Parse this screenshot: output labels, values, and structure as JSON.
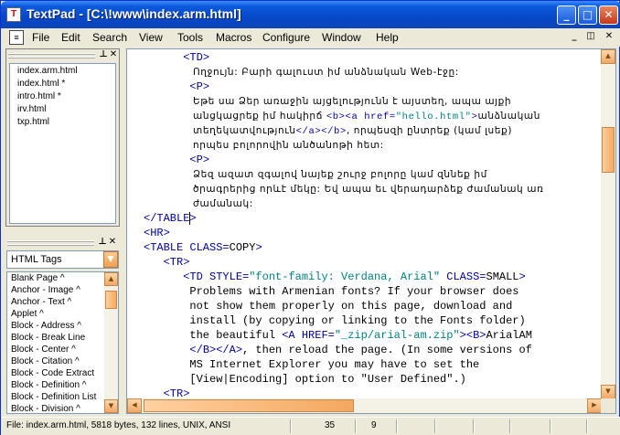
{
  "window": {
    "title": "TextPad - [C:\\!www\\index.arm.html]",
    "app_icon": "textpad-app-icon",
    "title_icon_glyph": "T",
    "controls": {
      "minimize": "_",
      "maximize": "□",
      "close": "✕"
    }
  },
  "menubar": {
    "items": [
      "File",
      "Edit",
      "Search",
      "View",
      "Tools",
      "Macros",
      "Configure",
      "Window",
      "Help"
    ],
    "app_icon_glyph": "≡",
    "mdi_controls": {
      "minimize": "_",
      "restore": "◫",
      "close": "✕"
    }
  },
  "document_selector": {
    "files": [
      "index.arm.html",
      "index.html *",
      "intro.html *",
      "irv.html",
      "txp.html"
    ],
    "selected": "index.arm.html",
    "pin_glyph": "⊥",
    "close_glyph": "✕"
  },
  "clip_library": {
    "selected_library": "HTML Tags",
    "dropdown_glyph": "▼",
    "pin_glyph": "⊥",
    "close_glyph": "✕",
    "items": [
      "Blank Page ^",
      "Anchor - Image ^",
      "Anchor - Text ^",
      "Applet ^",
      "Block - Address ^",
      "Block - Break Line",
      "Block - Center ^",
      "Block - Citation ^",
      "Block - Code Extract",
      "Block - Definition ^",
      "Block - Definition List",
      "Block - Division ^"
    ],
    "scroll_up_glyph": "▲",
    "scroll_down_glyph": "▼"
  },
  "editor": {
    "lines": [
      [
        {
          "t": "      "
        },
        {
          "t": "<TD>",
          "c": "tag"
        }
      ],
      [
        {
          "t": "Ողջույն: Բարի գալուստ իմ անձնական Web-էջը:",
          "arm": true
        }
      ],
      [
        {
          "t": "       "
        },
        {
          "t": "<P>",
          "c": "tag"
        }
      ],
      [
        {
          "t": "Եթե սա Ձեր առաջին այցելությունն է այստեղ, ապա այքի",
          "arm": true
        }
      ],
      [
        {
          "t": "անցկացրեք իմ հակիրճ ",
          "arm": true
        },
        {
          "t": "<b><a href=",
          "c": "tag"
        },
        {
          "t": "\"hello.html\"",
          "c": "str"
        },
        {
          "t": ">",
          "c": "tag"
        },
        {
          "t": "անձնական",
          "arm": true
        }
      ],
      [
        {
          "t": "տեղեկատվություն",
          "arm": true
        },
        {
          "t": "</a></b>",
          "c": "tag"
        },
        {
          "t": ", որպեսզի ընտրեք (կամ լսեք)",
          "arm": true
        }
      ],
      [
        {
          "t": "որպես բոլորովին անծանոթի հետ:",
          "arm": true
        }
      ],
      [
        {
          "t": "       "
        },
        {
          "t": "<P>",
          "c": "tag"
        }
      ],
      [
        {
          "t": "Ձեզ ազատ զգալով նայեք շուրջ բոլորը կամ զննեք իմ",
          "arm": true
        }
      ],
      [
        {
          "t": "ծրագրերից որևէ մեկը: Եվ ապա եւ վերադարձեք ժամանակ առ",
          "arm": true
        }
      ],
      [
        {
          "t": "ժամանակ:",
          "arm": true
        }
      ],
      [
        {
          "t": "</TABLE>",
          "c": "tag"
        }
      ],
      [
        {
          "t": "<HR>",
          "c": "tag"
        }
      ],
      [
        {
          "t": "<TABLE CLASS=",
          "c": "tag"
        },
        {
          "t": "COPY"
        },
        {
          "t": ">",
          "c": "tag"
        }
      ],
      [
        {
          "t": "   "
        },
        {
          "t": "<TR>",
          "c": "tag"
        }
      ],
      [
        {
          "t": "      "
        },
        {
          "t": "<TD STYLE=",
          "c": "tag"
        },
        {
          "t": "\"font-family: Verdana, Arial\"",
          "c": "str"
        },
        {
          "t": " CLASS=",
          "c": "tag"
        },
        {
          "t": "SMALL"
        },
        {
          "t": ">",
          "c": "tag"
        }
      ],
      [
        {
          "t": "       Problems with Armenian fonts? If your browser does"
        }
      ],
      [
        {
          "t": "       not show them properly on this page, download and"
        }
      ],
      [
        {
          "t": "       install (by copying or linking to the Fonts folder)"
        }
      ],
      [
        {
          "t": "       the beautiful "
        },
        {
          "t": "<A HREF=",
          "c": "tag"
        },
        {
          "t": "\"_zip/arial-am.zip\"",
          "c": "str"
        },
        {
          "t": "><B>",
          "c": "tag"
        },
        {
          "t": "ArialAM"
        }
      ],
      [
        {
          "t": "       "
        },
        {
          "t": "</B></A>",
          "c": "tag"
        },
        {
          "t": ", then reload the page. (In some versions of"
        }
      ],
      [
        {
          "t": "       MS Internet Explorer you may have to set the"
        }
      ],
      [
        {
          "t": "       [View|Encoding] option to \"User Defined\".)"
        }
      ],
      [
        {
          "t": "   "
        },
        {
          "t": "<TR>",
          "c": "tag"
        }
      ]
    ],
    "caret_line_index": 11,
    "caret_col": 8,
    "scroll_up_glyph": "▲",
    "scroll_down_glyph": "▼",
    "scroll_left_glyph": "◀",
    "scroll_right_glyph": "▶"
  },
  "status": {
    "file_info": "File: index.arm.html, 5818 bytes, 132 lines, UNIX, ANSI",
    "line": "35",
    "column": "9"
  },
  "colors": {
    "tag": "#00009c",
    "string": "#008080",
    "title_gradient_top": "#3c8cf9",
    "title_gradient_bottom": "#0a44b8",
    "chrome": "#ece9d8"
  }
}
